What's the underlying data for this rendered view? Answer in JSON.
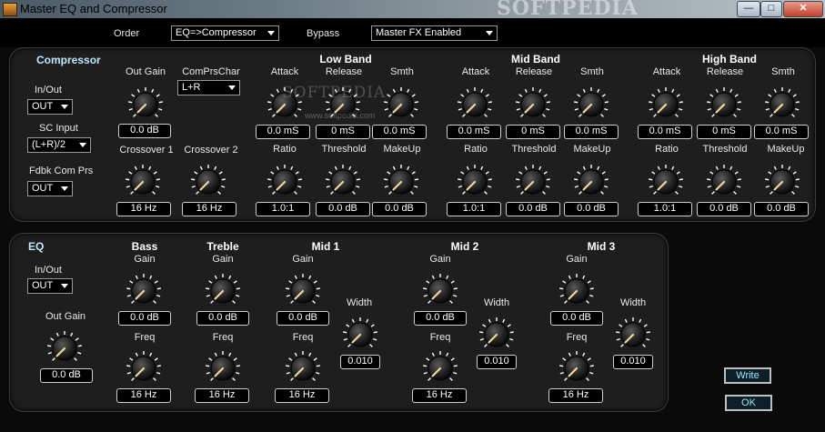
{
  "window": {
    "title": "Master  EQ and Compressor",
    "watermark": "SOFTPEDIA",
    "watermark_url": "www.softpedia.com",
    "controls": {
      "minimize": "—",
      "maximize": "□",
      "close": "✕"
    }
  },
  "topbar": {
    "order_label": "Order",
    "order_value": "EQ=>Compressor",
    "bypass_label": "Bypass",
    "bypass_value": "Master FX Enabled"
  },
  "compressor": {
    "title": "Compressor",
    "inout_label": "In/Out",
    "inout_value": "OUT",
    "sc_input_label": "SC Input",
    "sc_input_value": "(L+R)/2",
    "fdbk_label": "Fdbk Com Prs",
    "fdbk_value": "OUT",
    "out_gain_label": "Out Gain",
    "out_gain_value": "0.0 dB",
    "comprschar_label": "ComPrsChar",
    "comprschar_value": "L+R",
    "crossover1_label": "Crossover 1",
    "crossover1_value": "16 Hz",
    "crossover2_label": "Crossover 2",
    "crossover2_value": "16 Hz",
    "bands": [
      {
        "title": "Low Band",
        "attack_label": "Attack",
        "attack": "0.0 mS",
        "release_label": "Release",
        "release": "0 mS",
        "smth_label": "Smth",
        "smth": "0.0 mS",
        "ratio_label": "Ratio",
        "ratio": "1.0:1",
        "threshold_label": "Threshold",
        "threshold": "0.0 dB",
        "makeup_label": "MakeUp",
        "makeup": "0.0 dB"
      },
      {
        "title": "Mid Band",
        "attack_label": "Attack",
        "attack": "0.0 mS",
        "release_label": "Release",
        "release": "0 mS",
        "smth_label": "Smth",
        "smth": "0.0 mS",
        "ratio_label": "Ratio",
        "ratio": "1.0:1",
        "threshold_label": "Threshold",
        "threshold": "0.0 dB",
        "makeup_label": "MakeUp",
        "makeup": "0.0 dB"
      },
      {
        "title": "High Band",
        "attack_label": "Attack",
        "attack": "0.0 mS",
        "release_label": "Release",
        "release": "0 mS",
        "smth_label": "Smth",
        "smth": "0.0 mS",
        "ratio_label": "Ratio",
        "ratio": "1.0:1",
        "threshold_label": "Threshold",
        "threshold": "0.0 dB",
        "makeup_label": "MakeUp",
        "makeup": "0.0 dB"
      }
    ]
  },
  "eq": {
    "title": "EQ",
    "inout_label": "In/Out",
    "inout_value": "OUT",
    "out_gain_label": "Out Gain",
    "out_gain_value": "0.0 dB",
    "bass": {
      "title": "Bass",
      "gain_label": "Gain",
      "gain": "0.0 dB",
      "freq_label": "Freq",
      "freq": "16 Hz"
    },
    "treble": {
      "title": "Treble",
      "gain_label": "Gain",
      "gain": "0.0 dB",
      "freq_label": "Freq",
      "freq": "16 Hz"
    },
    "mids": [
      {
        "title": "Mid 1",
        "gain_label": "Gain",
        "gain": "0.0 dB",
        "freq_label": "Freq",
        "freq": "16 Hz",
        "width_label": "Width",
        "width": "0.010"
      },
      {
        "title": "Mid 2",
        "gain_label": "Gain",
        "gain": "0.0 dB",
        "freq_label": "Freq",
        "freq": "16 Hz",
        "width_label": "Width",
        "width": "0.010"
      },
      {
        "title": "Mid 3",
        "gain_label": "Gain",
        "gain": "0.0 dB",
        "freq_label": "Freq",
        "freq": "16 Hz",
        "width_label": "Width",
        "width": "0.010"
      }
    ]
  },
  "actions": {
    "write_label": "Write",
    "ok_label": "OK"
  },
  "colors": {
    "accent_text": "#bfe8ff",
    "button_text": "#9be7ff",
    "pointer": "#f0d79a",
    "knob_ticks": "#ffffff"
  }
}
